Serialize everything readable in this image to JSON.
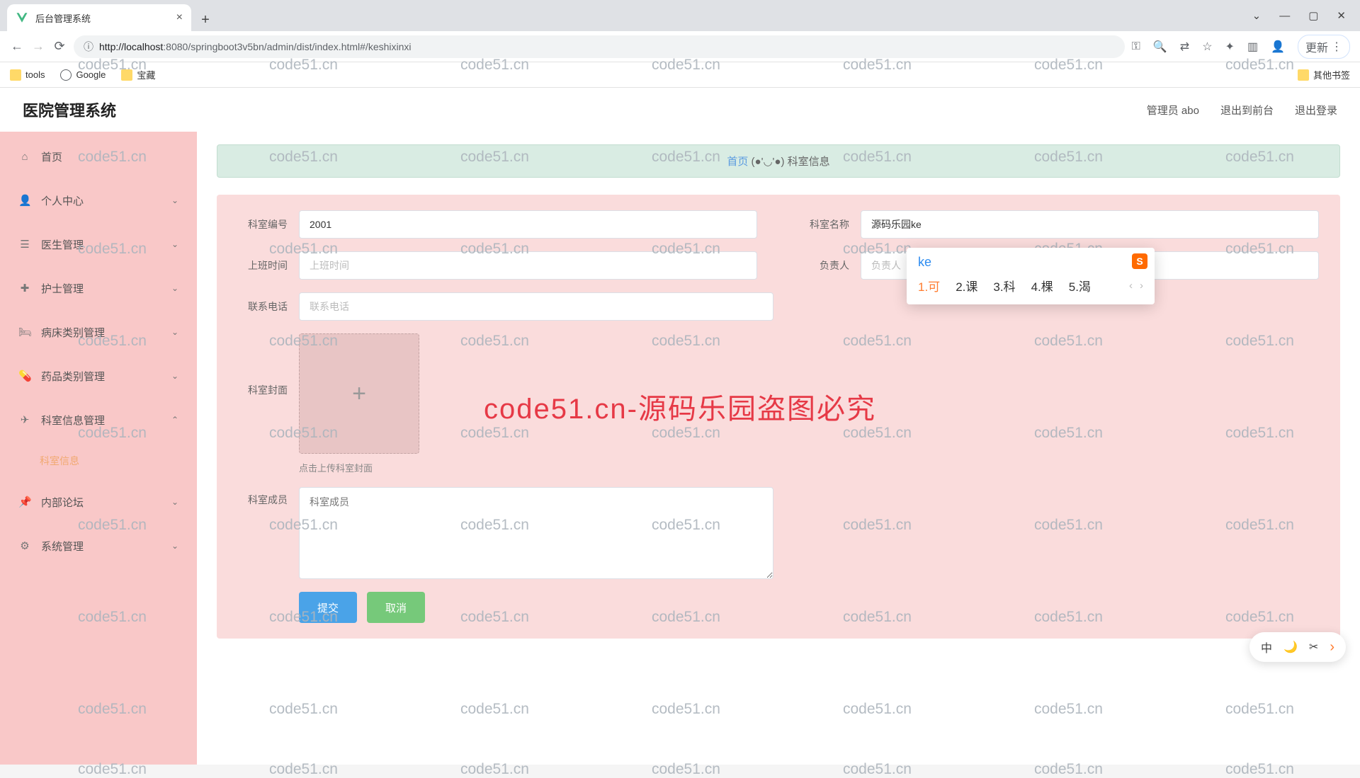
{
  "browser": {
    "tab_title": "后台管理系统",
    "url_host": "localhost",
    "url_port": ":8080",
    "url_path": "/springboot3v5bn/admin/dist/index.html#/keshixinxi",
    "update_label": "更新"
  },
  "bookmarks": {
    "items": [
      "tools",
      "Google",
      "宝藏"
    ],
    "other": "其他书签"
  },
  "app": {
    "title": "医院管理系统",
    "header_right": [
      "管理员 abo",
      "退出到前台",
      "退出登录"
    ]
  },
  "sidebar": {
    "items": [
      {
        "label": "首页",
        "icon": "⌂",
        "exp": false
      },
      {
        "label": "个人中心",
        "icon": "👤",
        "exp": true
      },
      {
        "label": "医生管理",
        "icon": "🗂",
        "exp": true
      },
      {
        "label": "护士管理",
        "icon": "✚",
        "exp": true
      },
      {
        "label": "病床类别管理",
        "icon": "🛏",
        "exp": true
      },
      {
        "label": "药品类别管理",
        "icon": "💊",
        "exp": true
      },
      {
        "label": "科室信息管理",
        "icon": "✈",
        "exp": true,
        "open": true
      },
      {
        "label": "科室信息",
        "sub": true
      },
      {
        "label": "内部论坛",
        "icon": "📌",
        "exp": true
      },
      {
        "label": "系统管理",
        "icon": "⚙",
        "exp": true
      }
    ]
  },
  "breadcrumb": {
    "home": "首页",
    "sep": "(●'◡'●)",
    "current": "科室信息"
  },
  "form": {
    "code_label": "科室编号",
    "code_value": "2001",
    "name_label": "科室名称",
    "name_value": "源码乐园ke",
    "worktime_label": "上班时间",
    "worktime_ph": "上班时间",
    "owner_label": "负责人",
    "owner_ph": "负责人",
    "phone_label": "联系电话",
    "phone_ph": "联系电话",
    "cover_label": "科室封面",
    "cover_hint": "点击上传科室封面",
    "members_label": "科室成员",
    "members_ph": "科室成员",
    "submit": "提交",
    "cancel": "取消"
  },
  "ime": {
    "typed": "ke",
    "candidates": [
      "1.可",
      "2.课",
      "3.科",
      "4.棵",
      "5.渴"
    ]
  },
  "langbar": {
    "lang": "中"
  },
  "watermark": {
    "small": "code51.cn",
    "big": "code51.cn-源码乐园盗图必究"
  }
}
